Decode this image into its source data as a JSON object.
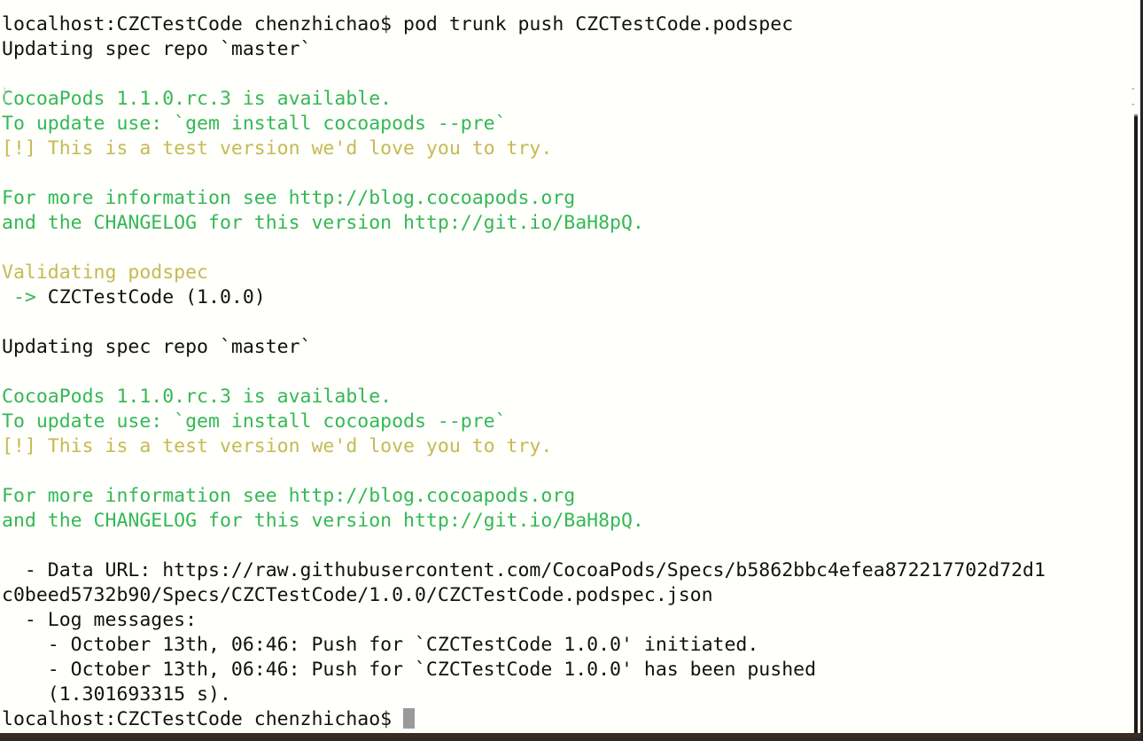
{
  "window": {
    "app": "Terminal",
    "shell_prompt": "localhost:CZCTestCode chenzhichao$",
    "cursor": "block-cursor"
  },
  "colors": {
    "background": "#fffffc",
    "default_text": "#111111",
    "green": "#34b855",
    "yellow": "#c6ba52",
    "cursor": "#9a9a9a",
    "window_border": "#2a2320"
  },
  "artifacts": {
    "paste_bracket_left": "[",
    "paste_bracket_right": "]"
  },
  "terminal": {
    "lines": [
      {
        "id": "line-command",
        "segments": [
          {
            "text": "localhost:CZCTestCode chenzhichao$ pod trunk push CZCTestCode.podspec",
            "color": "c-default"
          }
        ]
      },
      {
        "id": "line-updating-1",
        "segments": [
          {
            "text": "Updating spec repo `master`",
            "color": "c-default"
          }
        ]
      },
      {
        "id": "line-blank-1",
        "segments": [
          {
            "text": " ",
            "color": "c-default"
          }
        ]
      },
      {
        "id": "line-cocoapods-avail-1",
        "segments": [
          {
            "text": "CocoaPods 1.1.0.rc.3 is available.",
            "color": "c-green"
          }
        ]
      },
      {
        "id": "line-update-use-1",
        "segments": [
          {
            "text": "To update use: `gem install cocoapods --pre`",
            "color": "c-green"
          }
        ]
      },
      {
        "id": "line-test-version-1",
        "segments": [
          {
            "text": "[!] This is a test version we'd love you to try.",
            "color": "c-yellow"
          }
        ]
      },
      {
        "id": "line-blank-2",
        "segments": [
          {
            "text": " ",
            "color": "c-default"
          }
        ]
      },
      {
        "id": "line-more-info-1",
        "segments": [
          {
            "text": "For more information see http://blog.cocoapods.org",
            "color": "c-green"
          }
        ]
      },
      {
        "id": "line-changelog-1",
        "segments": [
          {
            "text": "and the CHANGELOG for this version http://git.io/BaH8pQ.",
            "color": "c-green"
          }
        ]
      },
      {
        "id": "line-blank-3",
        "segments": [
          {
            "text": " ",
            "color": "c-default"
          }
        ]
      },
      {
        "id": "line-validating",
        "segments": [
          {
            "text": "Validating podspec",
            "color": "c-yellow"
          }
        ]
      },
      {
        "id": "line-pod-name",
        "segments": [
          {
            "text": " -> ",
            "color": "c-green"
          },
          {
            "text": "CZCTestCode (1.0.0)",
            "color": "c-default"
          }
        ]
      },
      {
        "id": "line-blank-4",
        "segments": [
          {
            "text": " ",
            "color": "c-default"
          }
        ]
      },
      {
        "id": "line-updating-2",
        "segments": [
          {
            "text": "Updating spec repo `master`",
            "color": "c-default"
          }
        ]
      },
      {
        "id": "line-blank-5",
        "segments": [
          {
            "text": " ",
            "color": "c-default"
          }
        ]
      },
      {
        "id": "line-cocoapods-avail-2",
        "segments": [
          {
            "text": "CocoaPods 1.1.0.rc.3 is available.",
            "color": "c-green"
          }
        ]
      },
      {
        "id": "line-update-use-2",
        "segments": [
          {
            "text": "To update use: `gem install cocoapods --pre`",
            "color": "c-green"
          }
        ]
      },
      {
        "id": "line-test-version-2",
        "segments": [
          {
            "text": "[!] This is a test version we'd love you to try.",
            "color": "c-yellow"
          }
        ]
      },
      {
        "id": "line-blank-6",
        "segments": [
          {
            "text": " ",
            "color": "c-default"
          }
        ]
      },
      {
        "id": "line-more-info-2",
        "segments": [
          {
            "text": "For more information see http://blog.cocoapods.org",
            "color": "c-green"
          }
        ]
      },
      {
        "id": "line-changelog-2",
        "segments": [
          {
            "text": "and the CHANGELOG for this version http://git.io/BaH8pQ.",
            "color": "c-green"
          }
        ]
      },
      {
        "id": "line-blank-7",
        "segments": [
          {
            "text": " ",
            "color": "c-default"
          }
        ]
      },
      {
        "id": "line-data-url",
        "segments": [
          {
            "text": "  - Data URL: https://raw.githubusercontent.com/CocoaPods/Specs/b5862bbc4efea872217702d72d1",
            "color": "c-default"
          }
        ]
      },
      {
        "id": "line-data-url-wrap",
        "segments": [
          {
            "text": "c0beed5732b90/Specs/CZCTestCode/1.0.0/CZCTestCode.podspec.json",
            "color": "c-default"
          }
        ]
      },
      {
        "id": "line-log-messages",
        "segments": [
          {
            "text": "  - Log messages:",
            "color": "c-default"
          }
        ]
      },
      {
        "id": "line-log-1",
        "segments": [
          {
            "text": "    - October 13th, 06:46: Push for `CZCTestCode 1.0.0' initiated.",
            "color": "c-default"
          }
        ]
      },
      {
        "id": "line-log-2",
        "segments": [
          {
            "text": "    - October 13th, 06:46: Push for `CZCTestCode 1.0.0' has been pushed",
            "color": "c-default"
          }
        ]
      },
      {
        "id": "line-log-2-wrap",
        "segments": [
          {
            "text": "    (1.301693315 s).",
            "color": "c-default"
          }
        ]
      }
    ],
    "prompt_line": {
      "id": "line-prompt-final",
      "text": "localhost:CZCTestCode chenzhichao$ "
    }
  }
}
